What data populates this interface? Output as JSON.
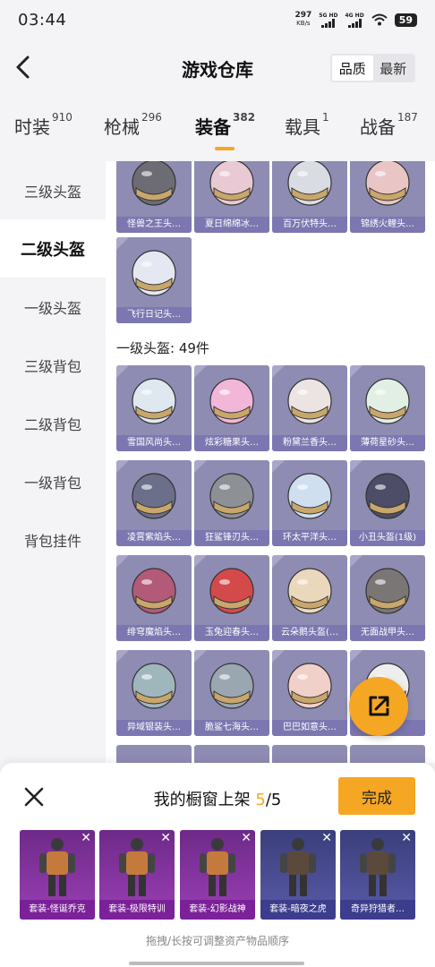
{
  "status": {
    "time": "03:44",
    "net_speed": "297",
    "net_unit": "KB/s",
    "sim1": "5G HD",
    "sim2": "4G HD",
    "battery": "59"
  },
  "header": {
    "title": "游戏仓库",
    "sort_options": [
      "品质",
      "最新"
    ]
  },
  "tabs": [
    {
      "label": "时装",
      "count": "910"
    },
    {
      "label": "枪械",
      "count": "296"
    },
    {
      "label": "装备",
      "count": "382"
    },
    {
      "label": "载具",
      "count": "1"
    },
    {
      "label": "战备",
      "count": "187"
    }
  ],
  "sidebar": [
    "三级头盔",
    "二级头盔",
    "一级头盔",
    "三级背包",
    "二级背包",
    "一级背包",
    "背包挂件"
  ],
  "level2_items": [
    "怪兽之王头…",
    "夏日绵绵冰…",
    "百万伏特头…",
    "锦绣火鲤头…",
    "飞行日记头…"
  ],
  "level1_section": "一级头盔: 49件",
  "level1_items": [
    "雪国风尚头…",
    "炫彩糖果头…",
    "粉黛兰香头…",
    "薄荷星砂头…",
    "凌霄紫焰头…",
    "狂鲨锋刃头…",
    "环太平洋头…",
    "小丑头盔(1级)",
    "绯穹魔焰头…",
    "玉兔迎春头…",
    "云朵鹅头盔(…",
    "无面战甲头…",
    "异域银装头…",
    "脆鲨七海头…",
    "巴巴如意头…",
    ""
  ],
  "colors": {
    "accent": "#f5a623",
    "card": "#8f8cb3",
    "card_label": "#7c77b0"
  },
  "sheet": {
    "title_prefix": "我的橱窗上架 ",
    "count": "5",
    "total": "/5",
    "done": "完成",
    "slots": [
      "套装-怪诞乔克",
      "套装-极限特训",
      "套装-幻影战神",
      "套装-暗夜之虎",
      "奇异狩猎者…"
    ],
    "hint": "拖拽/长按可调整资产物品顺序"
  }
}
